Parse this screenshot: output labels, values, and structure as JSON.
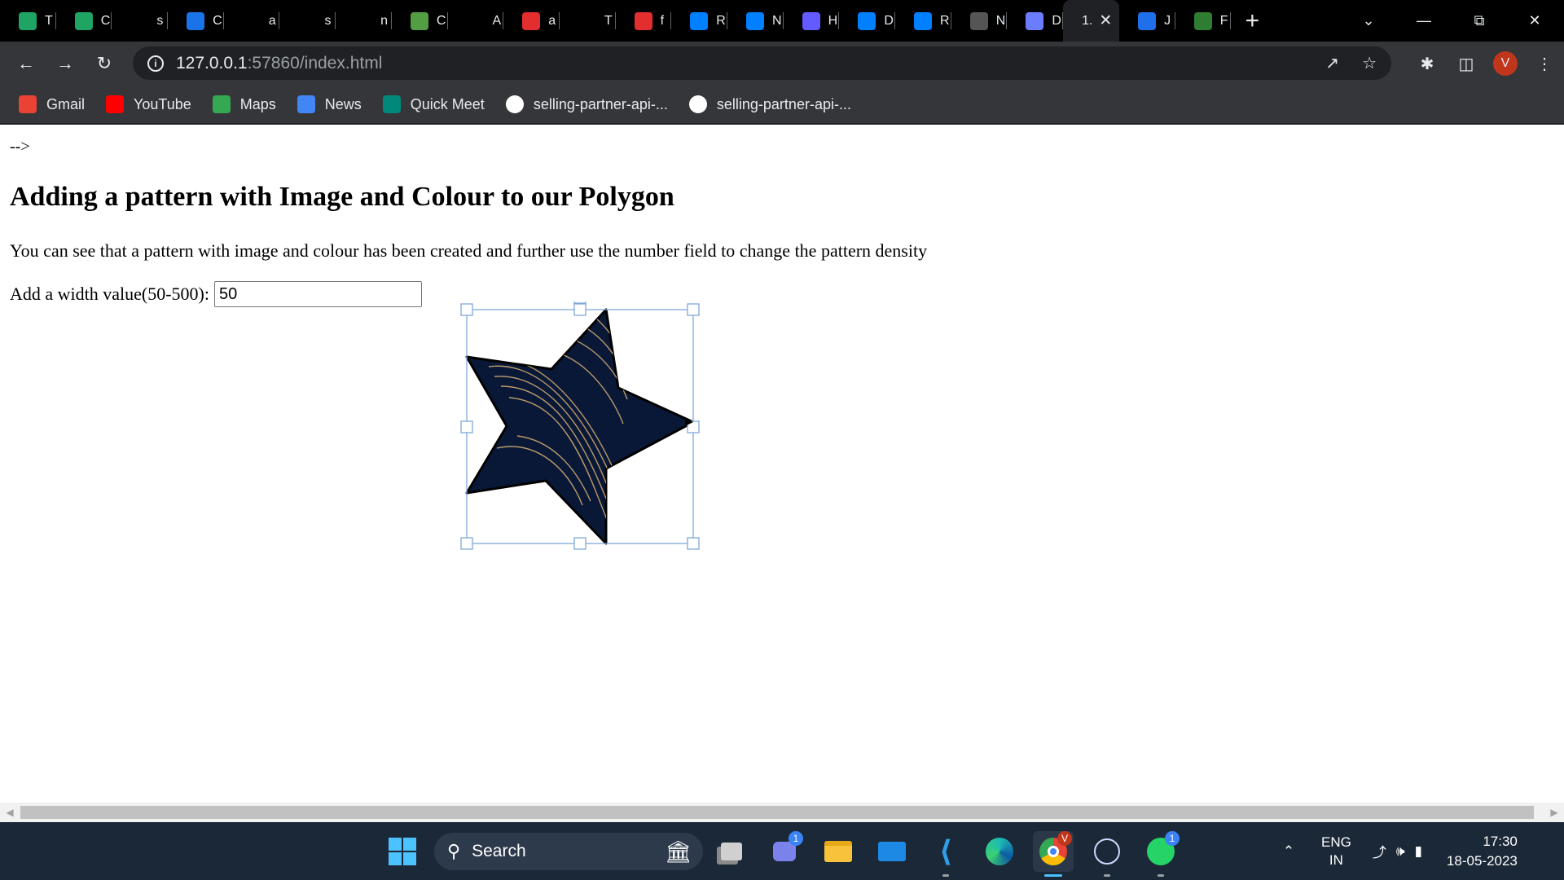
{
  "browser": {
    "tabs": [
      {
        "icon": "google-sheets-icon",
        "letter": "T",
        "color": "#1fa463"
      },
      {
        "icon": "google-sheets-icon",
        "letter": "C",
        "color": "#1fa463"
      },
      {
        "icon": "github-icon",
        "letter": "s",
        "color": "#000000"
      },
      {
        "icon": "docs-icon",
        "letter": "C",
        "color": "#1a73e8"
      },
      {
        "icon": "github-icon",
        "letter": "a",
        "color": "#000000"
      },
      {
        "icon": "github-icon",
        "letter": "s",
        "color": "#000000"
      },
      {
        "icon": "github-icon",
        "letter": "n",
        "color": "#000000"
      },
      {
        "icon": "nodejs-icon",
        "letter": "C",
        "color": "#539e43"
      },
      {
        "icon": "amazon-icon",
        "letter": "A",
        "color": "#000000"
      },
      {
        "icon": "n-icon",
        "letter": "a",
        "color": "#e22e2e"
      },
      {
        "icon": "github-icon",
        "letter": "T",
        "color": "#000000"
      },
      {
        "icon": "n-icon",
        "letter": "f",
        "color": "#e22e2e"
      },
      {
        "icon": "mui-icon",
        "letter": "R",
        "color": "#007fff"
      },
      {
        "icon": "mui-icon",
        "letter": "N",
        "color": "#007fff"
      },
      {
        "icon": "stripe-icon",
        "letter": "H",
        "color": "#635bff"
      },
      {
        "icon": "mui-icon",
        "letter": "D",
        "color": "#007fff"
      },
      {
        "icon": "mui-icon",
        "letter": "R",
        "color": "#007fff"
      },
      {
        "icon": "monday-icon",
        "letter": "N",
        "color": "#555555"
      },
      {
        "icon": "openai-icon",
        "letter": "D",
        "color": "#6b7cff"
      },
      {
        "icon": "",
        "letter": "1.",
        "color": "#202124"
      },
      {
        "icon": "jsfiddle-icon",
        "letter": "J",
        "color": "#1f6feb"
      },
      {
        "icon": "link-icon",
        "letter": "F",
        "color": "#2e7d32"
      }
    ],
    "active_tab_index": 19,
    "url_host": "127.0.0.1",
    "url_path": ":57860/index.html",
    "avatar_letter": "V",
    "bookmarks": [
      {
        "label": "Gmail",
        "icon": "gmail-icon",
        "color": "#ea4335"
      },
      {
        "label": "YouTube",
        "icon": "youtube-icon",
        "color": "#ff0000"
      },
      {
        "label": "Maps",
        "icon": "maps-icon",
        "color": "#34a853"
      },
      {
        "label": "News",
        "icon": "news-icon",
        "color": "#4285f4"
      },
      {
        "label": "Quick Meet",
        "icon": "meet-icon",
        "color": "#00897b"
      },
      {
        "label": "selling-partner-api-...",
        "icon": "github-icon",
        "color": "#ffffff"
      },
      {
        "label": "selling-partner-api-...",
        "icon": "github-icon",
        "color": "#ffffff"
      }
    ]
  },
  "page": {
    "comment_tail": "-->",
    "heading": "Adding a pattern with Image and Colour to our Polygon",
    "paragraph": "You can see that a pattern with image and colour has been created and further use the number field to change the pattern density",
    "width_label": "Add a width value(50-500):",
    "width_value": "50"
  },
  "colors": {
    "star_fill": "#0a1838",
    "star_pattern": "#b89a6a",
    "selection": "#7fa7d9"
  },
  "taskbar": {
    "search_label": "Search",
    "language_top": "ENG",
    "language_bottom": "IN",
    "time": "17:30",
    "date": "18-05-2023",
    "chat_badge": "1",
    "whatsapp_badge": "1"
  }
}
